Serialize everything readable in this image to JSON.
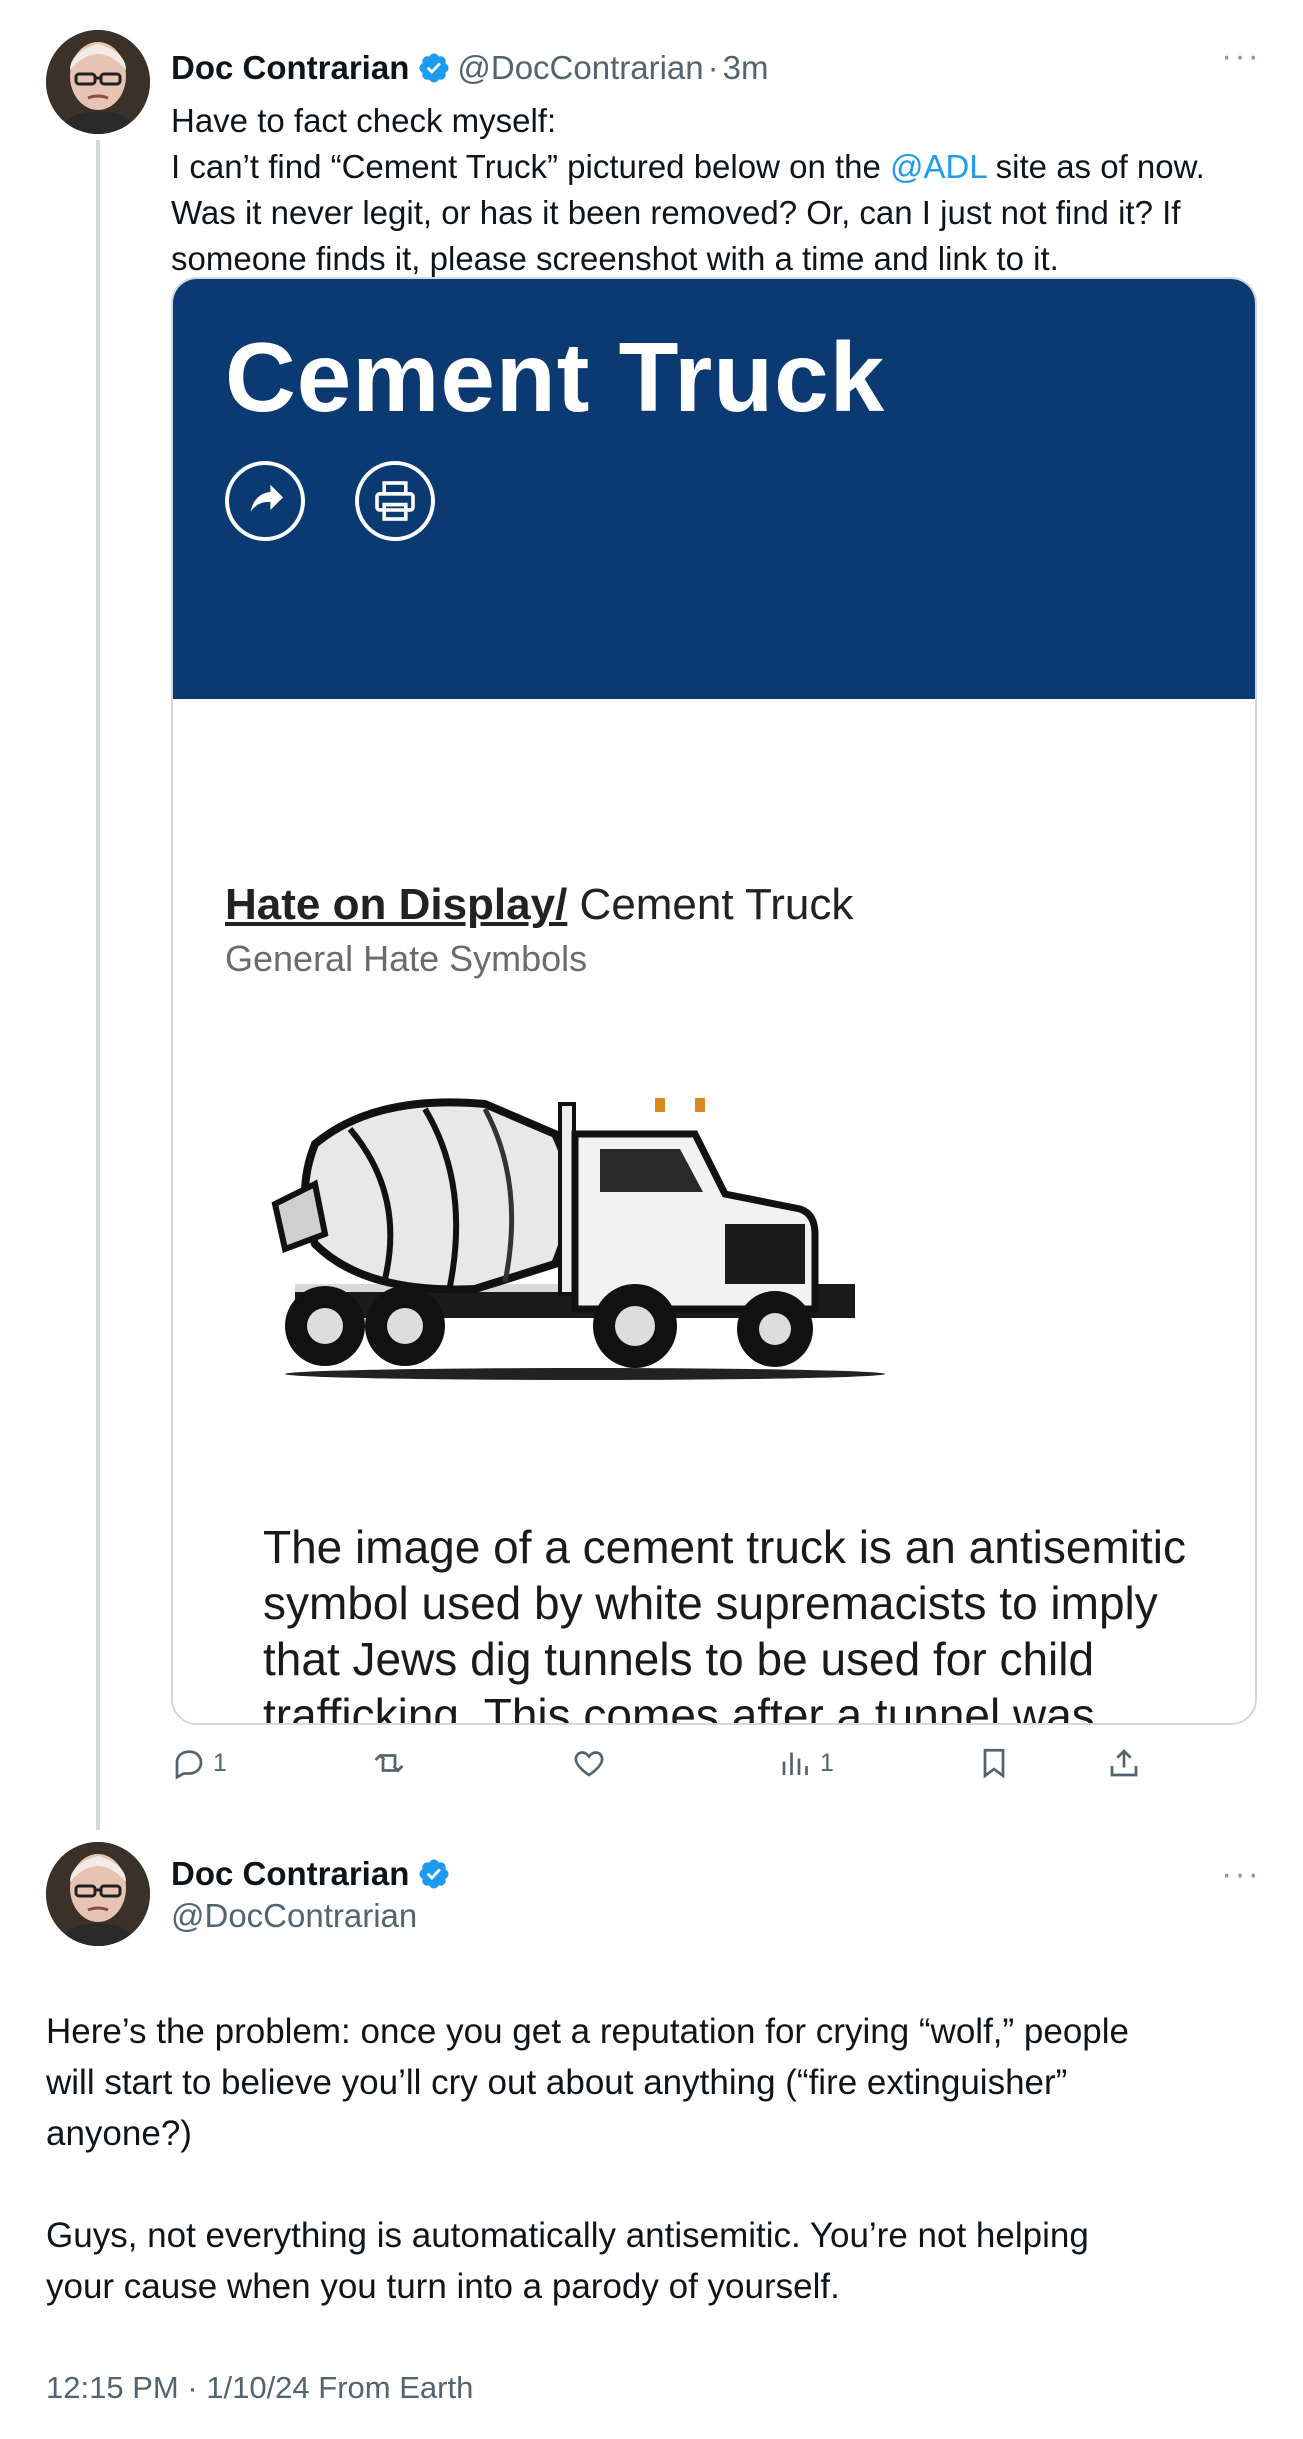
{
  "thread": {
    "tweet1": {
      "author_name": "Doc Contrarian",
      "handle": "@DocContrarian",
      "separator": "·",
      "time": "3m",
      "more": "···",
      "text_lines": [
        "Have to fact check myself:",
        "I can’t find “Cement Truck” pictured below on the ",
        "Was it never legit, or has it been removed? Or, can I just not find it? If",
        "someone finds it, please screenshot with a time and link to it."
      ],
      "mention": "@ADL",
      "mention_suffix": " site as of now.",
      "media": {
        "banner_color": "#0b3a73",
        "title": "Cement Truck",
        "share_icon": "share-icon",
        "print_icon": "printer-icon",
        "breadcrumb_link": "Hate on Display/",
        "breadcrumb_current": " Cement Truck",
        "category": "General Hate Symbols",
        "image": "cement-truck-illustration",
        "description_lines": [
          "The image of a cement truck is an antisemitic",
          "symbol used by white supremacists to imply",
          "that Jews dig tunnels to be used for child",
          "trafficking. This comes after a tunnel was"
        ]
      },
      "actions": {
        "reply_count": "1",
        "retweet_count": "",
        "like_count": "",
        "views_count": "1"
      }
    },
    "tweet2": {
      "author_name": "Doc Contrarian",
      "handle": "@DocContrarian",
      "more": "···",
      "text_lines": [
        "Here’s the problem: once you get a reputation for crying “wolf,”  people",
        "will start to believe you’ll cry out about anything (“fire extinguisher”",
        "anyone?)",
        "",
        "Guys, not everything is automatically antisemitic. You’re not helping",
        "your cause when you turn into a parody of yourself."
      ],
      "footer": "12:15 PM · 1/10/24 From Earth"
    }
  },
  "colors": {
    "link": "#1d9bf0",
    "secondary_text": "#536471",
    "verified": "#1d9bf0",
    "thread_line": "#cfd9de"
  }
}
